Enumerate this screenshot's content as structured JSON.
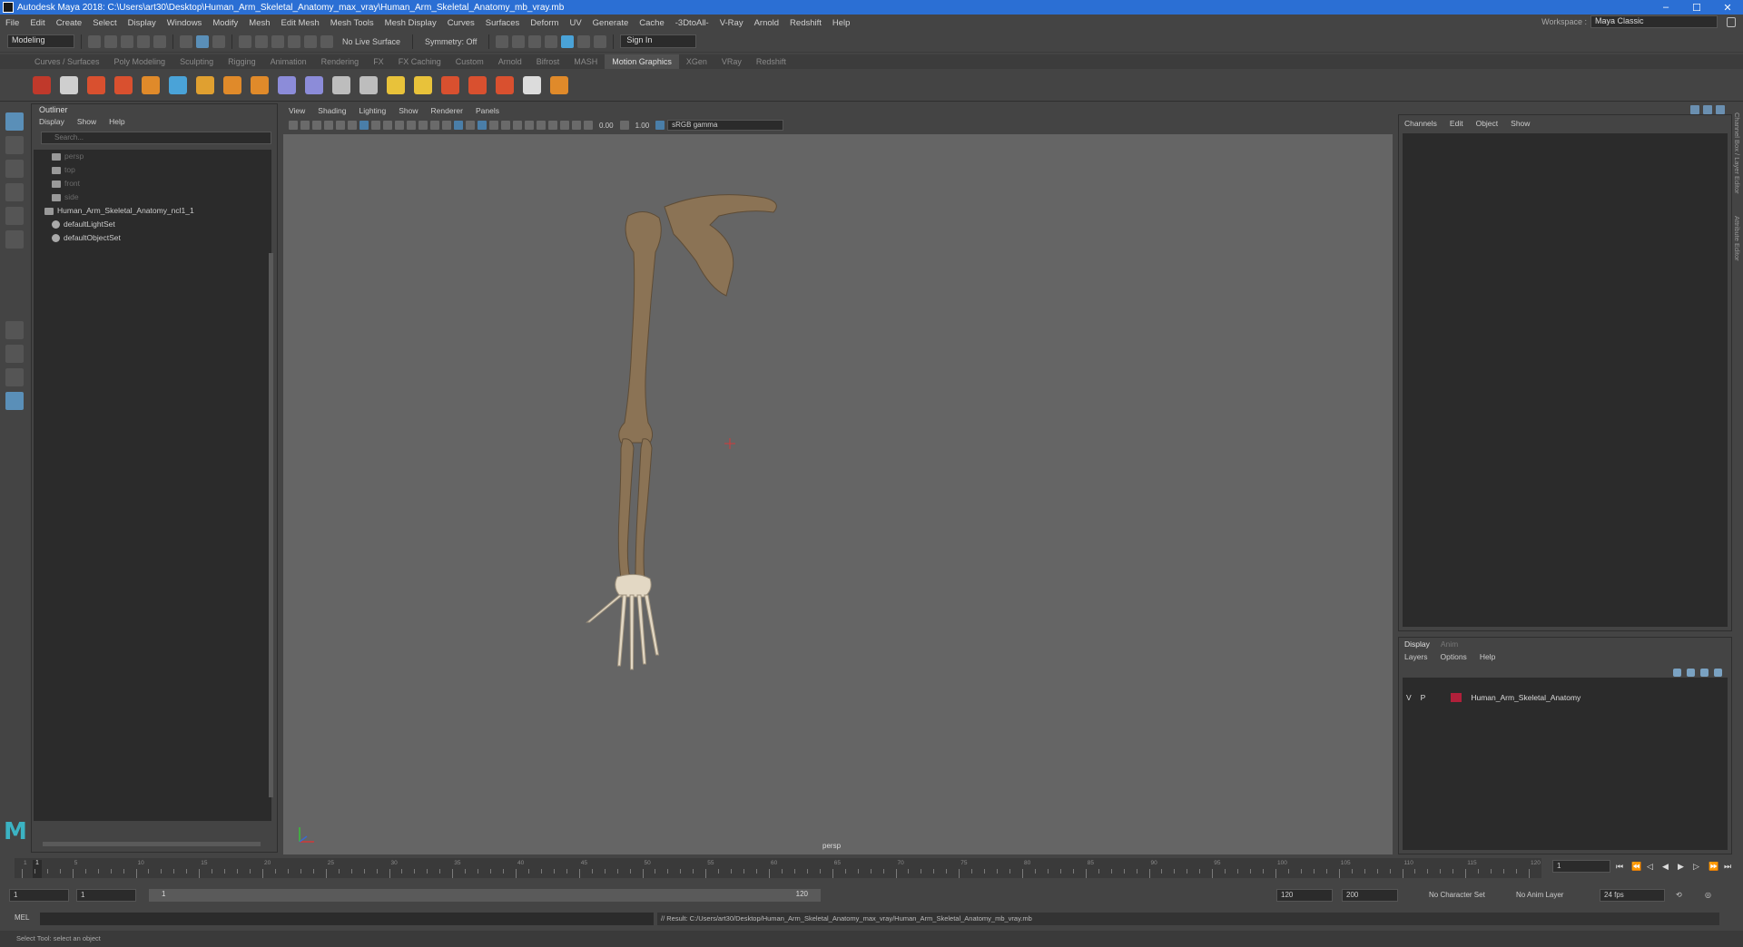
{
  "window": {
    "title": "Autodesk Maya 2018: C:\\Users\\art30\\Desktop\\Human_Arm_Skeletal_Anatomy_max_vray\\Human_Arm_Skeletal_Anatomy_mb_vray.mb",
    "minimize": "–",
    "maximize": "☐",
    "close": "✕"
  },
  "menubar": {
    "items": [
      "File",
      "Edit",
      "Create",
      "Select",
      "Display",
      "Windows",
      "Modify",
      "Mesh",
      "Edit Mesh",
      "Mesh Tools",
      "Mesh Display",
      "Curves",
      "Surfaces",
      "Deform",
      "UV",
      "Generate",
      "Cache",
      "-3DtoAll-",
      "V-Ray",
      "Arnold",
      "Redshift",
      "Help"
    ],
    "workspace_label": "Workspace :",
    "workspace_value": "Maya Classic"
  },
  "statusline": {
    "mode": "Modeling",
    "live_surface": "No Live Surface",
    "symmetry": "Symmetry: Off",
    "sign_in": "Sign In"
  },
  "shelf": {
    "tabs": [
      "Curves / Surfaces",
      "Poly Modeling",
      "Sculpting",
      "Rigging",
      "Animation",
      "Rendering",
      "FX",
      "FX Caching",
      "Custom",
      "Arnold",
      "Bifrost",
      "MASH",
      "Motion Graphics",
      "XGen",
      "VRay",
      "Redshift"
    ],
    "active_tab": "Motion Graphics",
    "icons": [
      {
        "name": "cube-icon",
        "color": "#c0392b"
      },
      {
        "name": "list-icon",
        "color": "#cfcfcf"
      },
      {
        "name": "text-icon",
        "color": "#d9502f"
      },
      {
        "name": "brush-icon",
        "color": "#d9502f"
      },
      {
        "name": "sphere-icon",
        "color": "#e08a2a"
      },
      {
        "name": "curve-icon",
        "color": "#4aa3d8"
      },
      {
        "name": "type-icon",
        "color": "#e0a030"
      },
      {
        "name": "svg-icon",
        "color": "#e08a2a"
      },
      {
        "name": "box-icon",
        "color": "#e08a2a"
      },
      {
        "name": "deform-icon",
        "color": "#8c8cd9"
      },
      {
        "name": "bend-icon",
        "color": "#8c8cd9"
      },
      {
        "name": "lattice-icon",
        "color": "#bdbdbd"
      },
      {
        "name": "twist-icon",
        "color": "#bdbdbd"
      },
      {
        "name": "light-icon",
        "color": "#e8c23a"
      },
      {
        "name": "sun-icon",
        "color": "#e8c23a"
      },
      {
        "name": "particles-icon",
        "color": "#d9502f"
      },
      {
        "name": "shirt-icon",
        "color": "#d9502f"
      },
      {
        "name": "cloth-icon",
        "color": "#d9502f"
      },
      {
        "name": "burst-icon",
        "color": "#dcdcdc"
      },
      {
        "name": "move-icon",
        "color": "#e08a2a"
      }
    ]
  },
  "outliner": {
    "title": "Outliner",
    "menus": [
      "Display",
      "Show",
      "Help"
    ],
    "search_placeholder": "Search...",
    "items": [
      {
        "label": "persp",
        "type": "camera",
        "dim": true
      },
      {
        "label": "top",
        "type": "camera",
        "dim": true
      },
      {
        "label": "front",
        "type": "camera",
        "dim": true
      },
      {
        "label": "side",
        "type": "camera",
        "dim": true
      },
      {
        "label": "Human_Arm_Skeletal_Anatomy_ncl1_1",
        "type": "group",
        "dim": false
      },
      {
        "label": "defaultLightSet",
        "type": "set",
        "dim": false
      },
      {
        "label": "defaultObjectSet",
        "type": "set",
        "dim": false
      }
    ]
  },
  "viewport": {
    "menus": [
      "View",
      "Shading",
      "Lighting",
      "Show",
      "Renderer",
      "Panels"
    ],
    "exposure": "0.00",
    "gamma": "1.00",
    "colorspace": "sRGB gamma",
    "camera": "persp",
    "bone_color": "#8b7355"
  },
  "channel_box": {
    "menus": [
      "Channels",
      "Edit",
      "Object",
      "Show"
    ],
    "side_labels": [
      "Channel Box / Layer Editor",
      "Attribute Editor"
    ]
  },
  "layer_editor": {
    "tabs": [
      "Display",
      "Anim"
    ],
    "active_tab": "Display",
    "menus": [
      "Layers",
      "Options",
      "Help"
    ],
    "layer": {
      "v": "V",
      "p": "P",
      "name": "Human_Arm_Skeletal_Anatomy",
      "color": "#b0203a"
    }
  },
  "timeslider": {
    "ticks": [
      "1",
      "5",
      "10",
      "15",
      "20",
      "25",
      "30",
      "35",
      "40",
      "45",
      "50",
      "55",
      "60",
      "65",
      "70",
      "75",
      "80",
      "85",
      "90",
      "95",
      "100",
      "105",
      "110",
      "115",
      "120"
    ],
    "current_frame": "1",
    "frame_field": "1"
  },
  "rangeslider": {
    "start": "1",
    "playback_start": "1",
    "range_start": "1",
    "range_end": "120",
    "playback_end": "120",
    "end": "200",
    "character_set": "No Character Set",
    "anim_layer": "No Anim Layer",
    "fps": "24 fps"
  },
  "cmdline": {
    "label": "MEL",
    "result": "// Result: C:/Users/art30/Desktop/Human_Arm_Skeletal_Anatomy_max_vray/Human_Arm_Skeletal_Anatomy_mb_vray.mb"
  },
  "helpline": {
    "text": "Select Tool: select an object"
  }
}
